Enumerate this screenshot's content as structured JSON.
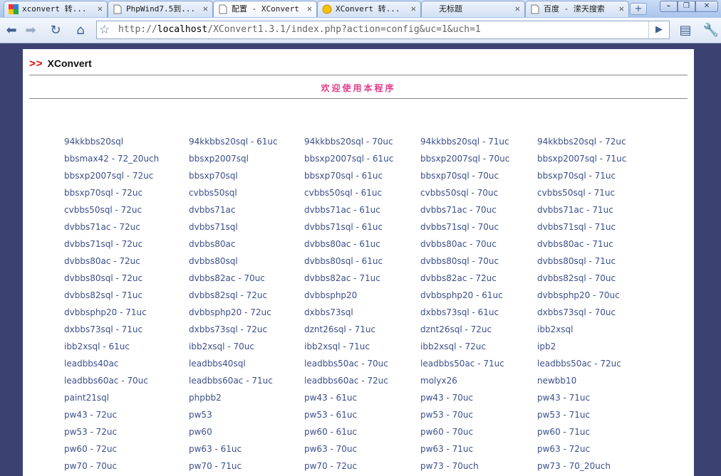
{
  "browser": {
    "tabs": [
      {
        "title": "xconvert 转...",
        "icon": "google-icon"
      },
      {
        "title": "PhpWind7.5到...",
        "icon": "page-icon"
      },
      {
        "title": "配置 - XConvert",
        "icon": "page-icon",
        "active": true
      },
      {
        "title": "XConvert 转...",
        "icon": "sun-icon"
      },
      {
        "title": "无标题",
        "icon": "none"
      },
      {
        "title": "百度 - 潆天搜索",
        "icon": "page-icon"
      }
    ],
    "new_tab_label": "+",
    "address": {
      "prefix": "http://",
      "host": "localhost",
      "path": "/XConvert1.3.1/index.php?action=config&uc=1&uch=1"
    },
    "window_controls": [
      "–",
      "❐",
      "✕"
    ]
  },
  "page": {
    "brand_arrows": ">>",
    "brand_name": "XConvert",
    "welcome": "欢迎使用本程序",
    "converters": [
      "94kkbbs20sql",
      "94kkbbs20sql - 61uc",
      "94kkbbs20sql - 70uc",
      "94kkbbs20sql - 71uc",
      "94kkbbs20sql - 72uc",
      "bbsmax42 - 72_20uch",
      "bbsxp2007sql",
      "bbsxp2007sql - 61uc",
      "bbsxp2007sql - 70uc",
      "bbsxp2007sql - 71uc",
      "bbsxp2007sql - 72uc",
      "bbsxp70sql",
      "bbsxp70sql - 61uc",
      "bbsxp70sql - 70uc",
      "bbsxp70sql - 71uc",
      "bbsxp70sql - 72uc",
      "cvbbs50sql",
      "cvbbs50sql - 61uc",
      "cvbbs50sql - 70uc",
      "cvbbs50sql - 71uc",
      "cvbbs50sql - 72uc",
      "dvbbs71ac",
      "dvbbs71ac - 61uc",
      "dvbbs71ac - 70uc",
      "dvbbs71ac - 71uc",
      "dvbbs71ac - 72uc",
      "dvbbs71sql",
      "dvbbs71sql - 61uc",
      "dvbbs71sql - 70uc",
      "dvbbs71sql - 71uc",
      "dvbbs71sql - 72uc",
      "dvbbs80ac",
      "dvbbs80ac - 61uc",
      "dvbbs80ac - 70uc",
      "dvbbs80ac - 71uc",
      "dvbbs80ac - 72uc",
      "dvbbs80sql",
      "dvbbs80sql - 61uc",
      "dvbbs80sql - 70uc",
      "dvbbs80sql - 71uc",
      "dvbbs80sql - 72uc",
      "dvbbs82ac - 70uc",
      "dvbbs82ac - 71uc",
      "dvbbs82ac - 72uc",
      "dvbbs82sql - 70uc",
      "dvbbs82sql - 71uc",
      "dvbbs82sql - 72uc",
      "dvbbsphp20",
      "dvbbsphp20 - 61uc",
      "dvbbsphp20 - 70uc",
      "dvbbsphp20 - 71uc",
      "dvbbsphp20 - 72uc",
      "dxbbs73sql",
      "dxbbs73sql - 61uc",
      "dxbbs73sql - 70uc",
      "dxbbs73sql - 71uc",
      "dxbbs73sql - 72uc",
      "dznt26sql - 71uc",
      "dznt26sql - 72uc",
      "ibb2xsql",
      "ibb2xsql - 61uc",
      "ibb2xsql - 70uc",
      "ibb2xsql - 71uc",
      "ibb2xsql - 72uc",
      "ipb2",
      "leadbbs40ac",
      "leadbbs40sql",
      "leadbbs50ac - 70uc",
      "leadbbs50ac - 71uc",
      "leadbbs50ac - 72uc",
      "leadbbs60ac - 70uc",
      "leadbbs60ac - 71uc",
      "leadbbs60ac - 72uc",
      "molyx26",
      "newbb10",
      "paint21sql",
      "phpbb2",
      "pw43 - 61uc",
      "pw43 - 70uc",
      "pw43 - 71uc",
      "pw43 - 72uc",
      "pw53",
      "pw53 - 61uc",
      "pw53 - 70uc",
      "pw53 - 71uc",
      "pw53 - 72uc",
      "pw60",
      "pw60 - 61uc",
      "pw60 - 70uc",
      "pw60 - 71uc",
      "pw60 - 72uc",
      "pw63 - 61uc",
      "pw63 - 70uc",
      "pw63 - 71uc",
      "pw63 - 72uc",
      "pw70 - 70uc",
      "pw70 - 71uc",
      "pw70 - 72uc",
      "pw73 - 70uch",
      "pw73 - 70_20uch"
    ]
  }
}
